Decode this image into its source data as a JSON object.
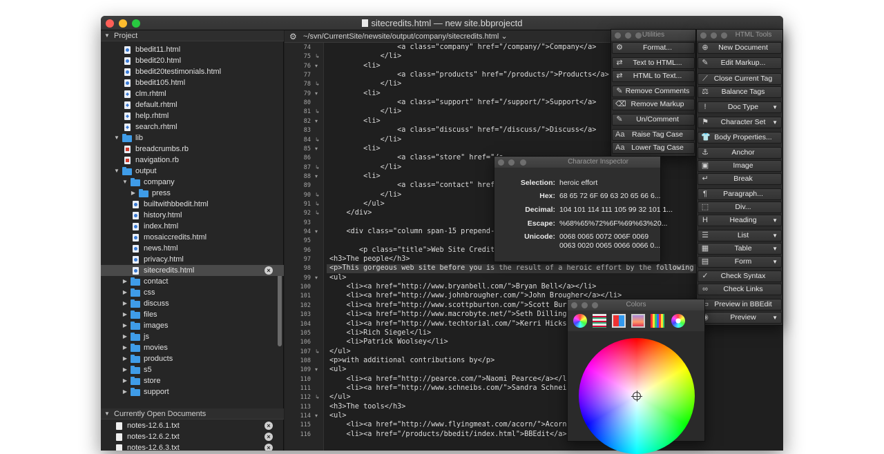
{
  "window": {
    "title": "sitecredits.html — new site.bbprojectd"
  },
  "sidebar": {
    "project_header": "Project",
    "rows": [
      {
        "label": "bbedit11.html",
        "kind": "html",
        "depth": 2
      },
      {
        "label": "bbedit20.html",
        "kind": "html",
        "depth": 2
      },
      {
        "label": "bbedit20testimonials.html",
        "kind": "html",
        "depth": 2
      },
      {
        "label": "bbedit105.html",
        "kind": "html",
        "depth": 2
      },
      {
        "label": "clm.rhtml",
        "kind": "rhtml",
        "depth": 2
      },
      {
        "label": "default.rhtml",
        "kind": "rhtml",
        "depth": 2
      },
      {
        "label": "help.rhtml",
        "kind": "rhtml",
        "depth": 2
      },
      {
        "label": "search.rhtml",
        "kind": "rhtml",
        "depth": 2
      },
      {
        "label": "lib",
        "kind": "folder-open",
        "depth": 1
      },
      {
        "label": "breadcrumbs.rb",
        "kind": "rb",
        "depth": 2
      },
      {
        "label": "navigation.rb",
        "kind": "rb",
        "depth": 2
      },
      {
        "label": "output",
        "kind": "folder-open",
        "depth": 1
      },
      {
        "label": "company",
        "kind": "folder-open",
        "depth": 2
      },
      {
        "label": "press",
        "kind": "folder-closed",
        "depth": 3
      },
      {
        "label": "builtwithbbedit.html",
        "kind": "html",
        "depth": 3
      },
      {
        "label": "history.html",
        "kind": "html",
        "depth": 3
      },
      {
        "label": "index.html",
        "kind": "html",
        "depth": 3
      },
      {
        "label": "mosaiccredits.html",
        "kind": "html",
        "depth": 3
      },
      {
        "label": "news.html",
        "kind": "html",
        "depth": 3
      },
      {
        "label": "privacy.html",
        "kind": "html",
        "depth": 3
      },
      {
        "label": "sitecredits.html",
        "kind": "html",
        "depth": 3,
        "selected": true
      },
      {
        "label": "contact",
        "kind": "folder-closed",
        "depth": 2
      },
      {
        "label": "css",
        "kind": "folder-closed",
        "depth": 2
      },
      {
        "label": "discuss",
        "kind": "folder-closed",
        "depth": 2
      },
      {
        "label": "files",
        "kind": "folder-closed",
        "depth": 2
      },
      {
        "label": "images",
        "kind": "folder-closed",
        "depth": 2
      },
      {
        "label": "js",
        "kind": "folder-closed",
        "depth": 2
      },
      {
        "label": "movies",
        "kind": "folder-closed",
        "depth": 2
      },
      {
        "label": "products",
        "kind": "folder-closed",
        "depth": 2
      },
      {
        "label": "s5",
        "kind": "folder-closed",
        "depth": 2
      },
      {
        "label": "store",
        "kind": "folder-closed",
        "depth": 2
      },
      {
        "label": "support",
        "kind": "folder-closed",
        "depth": 2
      }
    ],
    "open_docs_header": "Currently Open Documents",
    "open_docs": [
      "notes-12.6.1.txt",
      "notes-12.6.2.txt",
      "notes-12.6.3.txt"
    ]
  },
  "pathbar": {
    "path": "~/svn/CurrentSite/newsite/output/company/sitecredits.html"
  },
  "editor": {
    "lines": [
      {
        "n": "74",
        "fold": "",
        "code": "                <a class=\"company\" href=\"/company/\">Company</a>"
      },
      {
        "n": "75",
        "fold": "↳",
        "code": "            </li>"
      },
      {
        "n": "76",
        "fold": "▾",
        "code": "        <li>"
      },
      {
        "n": "77",
        "fold": "",
        "code": "                <a class=\"products\" href=\"/products/\">Products</a>"
      },
      {
        "n": "78",
        "fold": "↳",
        "code": "            </li>"
      },
      {
        "n": "79",
        "fold": "▾",
        "code": "        <li>"
      },
      {
        "n": "80",
        "fold": "",
        "code": "                <a class=\"support\" href=\"/support/\">Support</a>"
      },
      {
        "n": "81",
        "fold": "↳",
        "code": "            </li>"
      },
      {
        "n": "82",
        "fold": "▾",
        "code": "        <li>"
      },
      {
        "n": "83",
        "fold": "",
        "code": "                <a class=\"discuss\" href=\"/discuss/\">Discuss</a>"
      },
      {
        "n": "84",
        "fold": "↳",
        "code": "            </li>"
      },
      {
        "n": "85",
        "fold": "▾",
        "code": "        <li>"
      },
      {
        "n": "86",
        "fold": "",
        "code": "                <a class=\"store\" href=\"/s"
      },
      {
        "n": "87",
        "fold": "↳",
        "code": "            </li>"
      },
      {
        "n": "88",
        "fold": "▾",
        "code": "        <li>"
      },
      {
        "n": "89",
        "fold": "",
        "code": "                <a class=\"contact\" href=\""
      },
      {
        "n": "90",
        "fold": "↳",
        "code": "            </li>"
      },
      {
        "n": "91",
        "fold": "↳",
        "code": "        </ul>"
      },
      {
        "n": "92",
        "fold": "↳",
        "code": "    </div>"
      },
      {
        "n": "93",
        "fold": "",
        "code": ""
      },
      {
        "n": "94",
        "fold": "▾",
        "code": "    <div class=\"column span-15 prepend-2 f"
      },
      {
        "n": "95",
        "fold": "",
        "code": ""
      },
      {
        "n": "96",
        "fold": "",
        "code": "       <p class=\"title\">Web Site Credits</"
      },
      {
        "n": "97",
        "fold": "",
        "code": "<h3>The people</h3>"
      },
      {
        "n": "98",
        "fold": "",
        "code": "<p>This gorgeous web site before you is the result of a heroic effort by the following indiv"
      },
      {
        "n": "99",
        "fold": "▾",
        "code": "<ul>"
      },
      {
        "n": "100",
        "fold": "",
        "code": "    <li><a href=\"http://www.bryanbell.com/\">Bryan Bell</a></li>"
      },
      {
        "n": "101",
        "fold": "",
        "code": "    <li><a href=\"http://www.johnbrougher.com/\">John Brougher</a></li>"
      },
      {
        "n": "102",
        "fold": "",
        "code": "    <li><a href=\"http://www.scottpburton.com/\">Scott Burton-"
      },
      {
        "n": "103",
        "fold": "",
        "code": "    <li><a href=\"http://www.macrobyte.net/\">Seth Dillingham-"
      },
      {
        "n": "104",
        "fold": "",
        "code": "    <li><a href=\"http://www.techtorial.com/\">Kerri Hicks</"
      },
      {
        "n": "105",
        "fold": "",
        "code": "    <li>Rich Siegel</li>"
      },
      {
        "n": "106",
        "fold": "",
        "code": "    <li>Patrick Woolsey</li>"
      },
      {
        "n": "107",
        "fold": "↳",
        "code": "</ul>"
      },
      {
        "n": "108",
        "fold": "",
        "code": "<p>with additional contributions by</p>"
      },
      {
        "n": "109",
        "fold": "▾",
        "code": "<ul>"
      },
      {
        "n": "110",
        "fold": "",
        "code": "    <li><a href=\"http://pearce.com/\">Naomi Pearce</a></li>"
      },
      {
        "n": "111",
        "fold": "",
        "code": "    <li><a href=\"http://www.schneibs.com/\">Sandra Schneible-"
      },
      {
        "n": "112",
        "fold": "↳",
        "code": "</ul>"
      },
      {
        "n": "113",
        "fold": "",
        "code": "<h3>The tools</h3>"
      },
      {
        "n": "114",
        "fold": "▾",
        "code": "<ul>"
      },
      {
        "n": "115",
        "fold": "",
        "code": "    <li><a href=\"http://www.flyingmeat.com/acorn/\">Acorn</a"
      },
      {
        "n": "116",
        "fold": "",
        "code": "    <li><a href=\"/products/bbedit/index.html\">BBEdit</a></li>"
      }
    ]
  },
  "utilities": {
    "title": "Utilities",
    "buttons": [
      {
        "label": "Format...",
        "icon": "gear-icon"
      },
      {
        "label": "Text to HTML...",
        "icon": "doc-convert-icon"
      },
      {
        "label": "HTML to Text...",
        "icon": "doc-convert-icon"
      },
      {
        "label": "Remove Comments",
        "icon": "comment-icon"
      },
      {
        "label": "Remove Markup",
        "icon": "markup-icon"
      },
      {
        "label": "Un/Comment",
        "icon": "comment-icon"
      },
      {
        "label": "Raise Tag Case",
        "icon": "case-icon"
      },
      {
        "label": "Lower Tag Case",
        "icon": "case-icon"
      }
    ]
  },
  "html_tools": {
    "title": "HTML Tools",
    "buttons": [
      {
        "label": "New Document",
        "icon": "new-doc-icon",
        "menu": false
      },
      {
        "label": "Edit Markup...",
        "icon": "pencil-icon",
        "menu": false
      },
      {
        "label": "Close Current Tag",
        "icon": "tag-icon",
        "menu": false
      },
      {
        "label": "Balance Tags",
        "icon": "balance-icon",
        "menu": false
      },
      {
        "label": "Doc Type",
        "icon": "doctype-icon",
        "menu": true
      },
      {
        "label": "Character Set",
        "icon": "flag-icon",
        "menu": true
      },
      {
        "label": "Body Properties...",
        "icon": "shirt-icon",
        "menu": false
      },
      {
        "label": "Anchor",
        "icon": "anchor-icon",
        "menu": false
      },
      {
        "label": "Image",
        "icon": "image-icon",
        "menu": false
      },
      {
        "label": "Break",
        "icon": "return-icon",
        "menu": false
      },
      {
        "label": "Paragraph...",
        "icon": "pilcrow-icon",
        "menu": false
      },
      {
        "label": "Div...",
        "icon": "div-icon",
        "menu": false
      },
      {
        "label": "Heading",
        "icon": "heading-icon",
        "menu": true
      },
      {
        "label": "List",
        "icon": "list-icon",
        "menu": true
      },
      {
        "label": "Table",
        "icon": "table-icon",
        "menu": true
      },
      {
        "label": "Form",
        "icon": "form-icon",
        "menu": true
      },
      {
        "label": "Check Syntax",
        "icon": "check-icon",
        "menu": false
      },
      {
        "label": "Check Links",
        "icon": "link-icon",
        "menu": false
      },
      {
        "label": "Preview in BBEdit",
        "icon": "preview-icon",
        "menu": false
      },
      {
        "label": "Preview",
        "icon": "eye-icon",
        "menu": true
      }
    ]
  },
  "character_inspector": {
    "title": "Character Inspector",
    "rows": [
      {
        "label": "Selection:",
        "value": "heroic effort"
      },
      {
        "label": "Hex:",
        "value": "68 65 72 6F 69 63 20 65 66 6..."
      },
      {
        "label": "Decimal:",
        "value": "104 101 114 111 105 99 32 101 1..."
      },
      {
        "label": "Escape:",
        "value": "%68%65%72%6F%69%63%20..."
      },
      {
        "label": "Unicode:",
        "value": "0068 0065 0072 006F 0069",
        "value2": "0063 0020 0065 0066 0066 0..."
      }
    ]
  },
  "colors": {
    "title": "Colors"
  }
}
